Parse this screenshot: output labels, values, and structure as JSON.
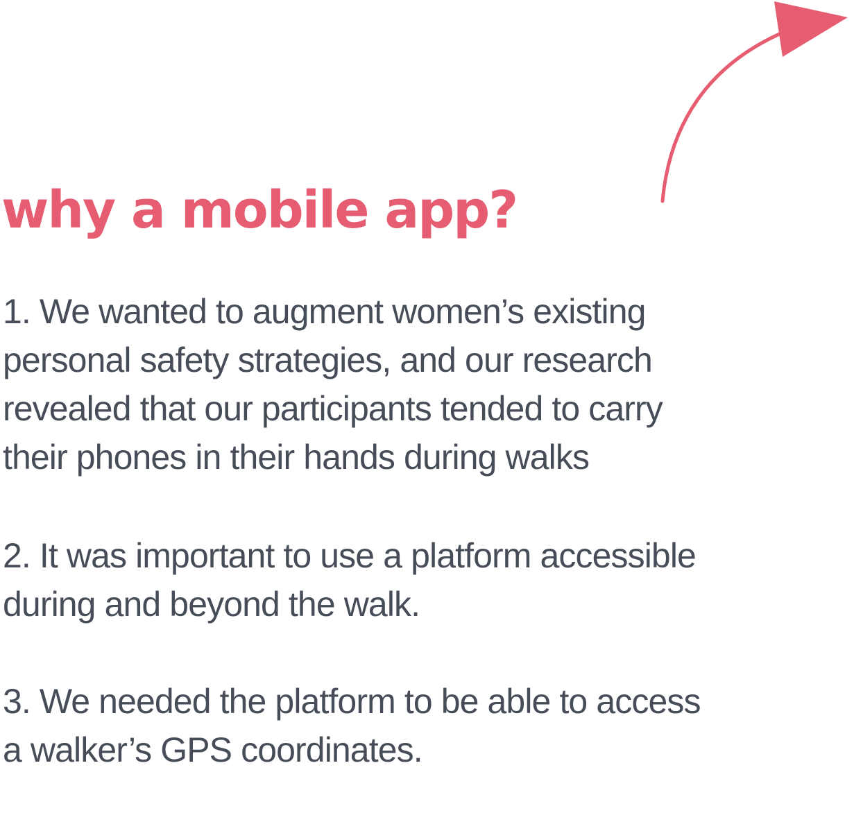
{
  "heading": "why a mobile app?",
  "points": [
    {
      "lines": [
        "1. We wanted to augment women’s existing",
        "personal safety strategies, and our research",
        "revealed that our participants tended to carry",
        "their phones in their hands during walks"
      ]
    },
    {
      "lines": [
        "2. It was important to use a platform accessible",
        "during and beyond the walk."
      ]
    },
    {
      "lines": [
        "3. We needed the platform to be able to access",
        "a walker’s GPS coordinates."
      ]
    }
  ],
  "colors": {
    "accent": "#e65c71",
    "body_text": "#474d58",
    "background": "#ffffff"
  },
  "icons": [
    "curved-arrow-icon"
  ]
}
